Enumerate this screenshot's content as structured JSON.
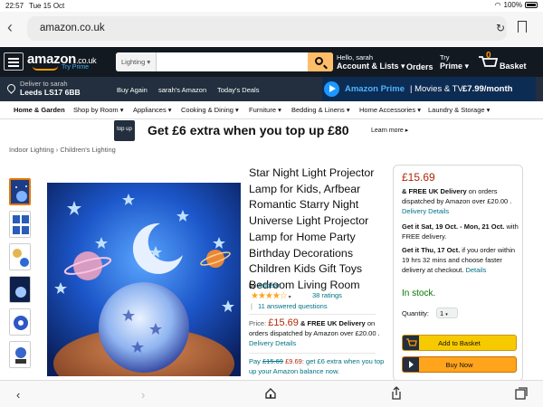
{
  "status_bar": {
    "time": "22:57",
    "date": "Tue 15 Oct",
    "battery": "100%"
  },
  "browser": {
    "url": "amazon.co.uk"
  },
  "header": {
    "logo": "amazon",
    "logo_domain": ".co.uk",
    "try_prime": "Try Prime",
    "search_category": "Lighting",
    "search_placeholder": "",
    "greeting": "Hello, sarah",
    "account_lists": "Account & Lists",
    "orders": "Orders",
    "try_label": "Try",
    "prime_label": "Prime",
    "basket_count": "0",
    "basket_label": "Basket"
  },
  "location_bar": {
    "deliver_to": "Deliver to sarah",
    "postcode": "Leeds LS17 6BB",
    "links": [
      "Buy Again",
      "sarah's Amazon",
      "Today's Deals"
    ],
    "prime_banner_brand": "Amazon Prime",
    "prime_banner_text": "| Movies & TV",
    "prime_banner_price": "£7.99/month"
  },
  "category_nav": [
    "Home & Garden",
    "Shop by Room",
    "Appliances",
    "Cooking & Dining",
    "Furniture",
    "Bedding & Linens",
    "Home Accessories",
    "Laundry & Storage"
  ],
  "ad": {
    "logo_text": "top up",
    "headline": "Get £6 extra when you top up £80",
    "learn_more": "Learn more"
  },
  "breadcrumbs": [
    "Indoor Lighting",
    "Children's Lighting"
  ],
  "product": {
    "title": "Star Night Light Projector Lamp for Kids, Arfbear Romantic Starry Night Universe Light Projector Lamp for Home Party Birthday Decorations Children Kids Gift Toys Bedroom Living Room",
    "by_label": "by",
    "brand": "Arfbear",
    "rating": 4.5,
    "ratings_count": "38 ratings",
    "answered": "11 answered questions",
    "price_label": "Price:",
    "price": "£15.69",
    "delivery_free": "& FREE UK Delivery",
    "delivery_rest": "on orders dispatched by Amazon over £20.00 .",
    "delivery_details": "Delivery Details",
    "topup_pay": "Pay",
    "topup_old": "£15.69",
    "topup_new": "£9.69",
    "topup_text": ": get £6 extra when you top up your Amazon balance now."
  },
  "buybox": {
    "price": "£15.69",
    "free_delivery": "& FREE UK Delivery",
    "delivery_text": "on orders dispatched by Amazon over £20.00 .",
    "delivery_details": "Delivery Details",
    "get_it_1": "Get it Sat, 19 Oct. - Mon, 21 Oct.",
    "get_it_1_tail": "with FREE delivery.",
    "get_it_2": "Get it Thu, 17 Oct.",
    "get_it_2_tail": "if you order within 19 hrs 32 mins and choose faster delivery at checkout.",
    "details": "Details",
    "stock": "In stock.",
    "quantity_label": "Quantity:",
    "quantity": "1",
    "add_to_basket": "Add to Basket",
    "buy_now": "Buy Now"
  },
  "colors": {
    "amazon_dark": "#131921",
    "nav_dark": "#232f3e",
    "orange": "#ff9900",
    "price_red": "#b12704",
    "link": "#007185",
    "stock_green": "#007600",
    "basket_btn": "#f7ca00",
    "buy_btn": "#ffa41c"
  }
}
